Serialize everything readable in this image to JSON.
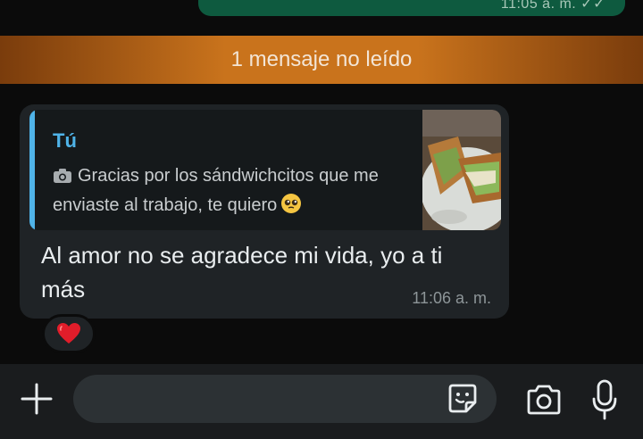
{
  "previous_message": {
    "meta": "11:05 a. m. ✓✓"
  },
  "unread_banner": {
    "text": "1 mensaje no leído"
  },
  "incoming_message": {
    "quote": {
      "author": "Tú",
      "icon": "camera-icon",
      "text": "Gracias por los sándwichcitos que me enviaste al trabajo, te quiero",
      "emoji": "pleading-face-emoji",
      "thumbnail": "sandwich-photo"
    },
    "text": "Al amor no se agradece mi vida, yo a ti más",
    "time": "11:06 a. m.",
    "reaction": "❤️"
  },
  "input_bar": {
    "placeholder": "",
    "icons": [
      "plus-icon",
      "sticker-icon",
      "camera-icon",
      "mic-icon"
    ]
  },
  "colors": {
    "background": "#0b0b0b",
    "outgoing_bubble": "#0e5a3f",
    "incoming_bubble": "#1f2326",
    "quote_accent": "#4fb3e8",
    "unread_banner": "#c9731c"
  }
}
